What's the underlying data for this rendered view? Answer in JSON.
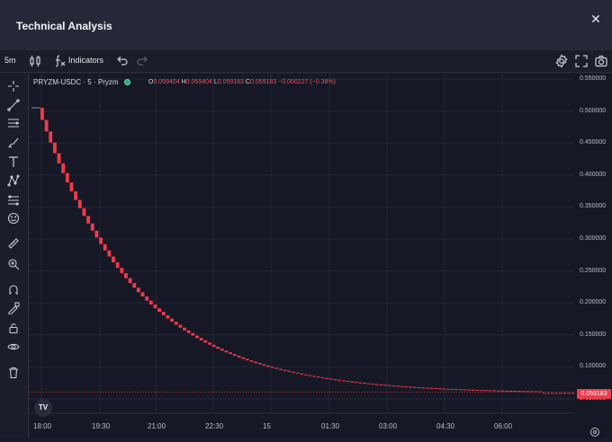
{
  "header": {
    "title": "Technical Analysis",
    "close_glyph": "✕"
  },
  "toolbar": {
    "interval": "5m",
    "indicators_label": "Indicators",
    "icons": [
      "candles-icon",
      "fx-icon",
      "undo-icon",
      "redo-icon",
      "settings-icon",
      "fullscreen-icon",
      "camera-icon"
    ]
  },
  "left_tools": [
    "crosshair-icon",
    "trendline-icon",
    "horizontal-lines-icon",
    "brush-icon",
    "text-icon",
    "pattern-icon",
    "fib-icon",
    "emoji-icon",
    "ruler-icon",
    "zoom-in-icon",
    "magnet-icon",
    "lock-draw-icon",
    "lock-icon",
    "eye-icon",
    "trash-icon"
  ],
  "legend": {
    "symbol": "PRYZM-USDC · 5 · Pryzm",
    "o_label": "O",
    "o": "0.059404",
    "h_label": "H",
    "h": "0.059404",
    "l_label": "L",
    "l": "0.059183",
    "c_label": "C",
    "c": "0.059183",
    "change": "−0.000227 (−0.38%)"
  },
  "last_price_tag": "0.059183",
  "logo_text": "TV",
  "colors": {
    "down": "#ef3b4d",
    "background": "#161825",
    "grid": "#232636"
  },
  "chart_data": {
    "type": "line",
    "title": "",
    "y_ticks": [
      "0.550000",
      "0.500000",
      "0.450000",
      "0.400000",
      "0.350000",
      "0.300000",
      "0.250000",
      "0.200000",
      "0.150000",
      "0.100000",
      "0.050000"
    ],
    "x_ticks": [
      "18:00",
      "19:30",
      "21:00",
      "22:30",
      "15",
      "01:30",
      "03:00",
      "04:30",
      "06:00"
    ],
    "ylim": [
      0.03,
      0.56
    ],
    "series": [
      {
        "x": [
          "18:00",
          "19:30",
          "21:00",
          "22:30",
          "00:00",
          "01:30",
          "03:00",
          "04:30",
          "06:00",
          "07:00"
        ],
        "values": [
          0.505,
          0.31,
          0.215,
          0.163,
          0.128,
          0.102,
          0.085,
          0.072,
          0.062,
          0.0592
        ]
      }
    ],
    "grid": true
  }
}
